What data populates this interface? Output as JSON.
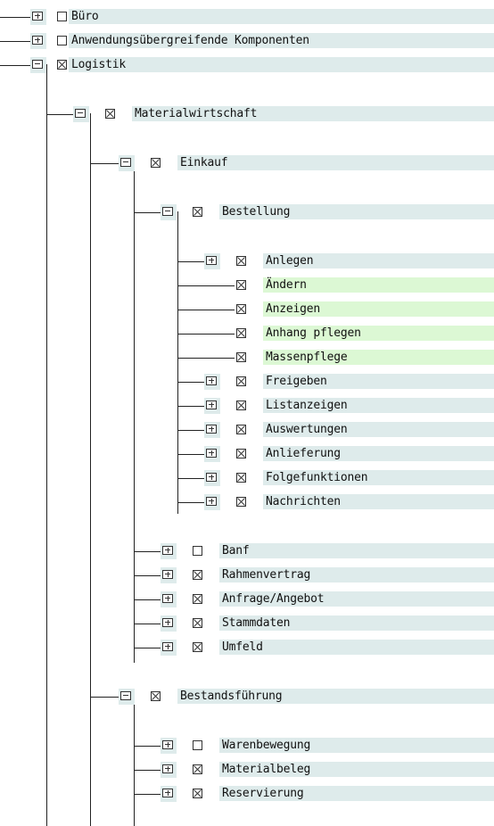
{
  "tree": {
    "nodes": [
      {
        "label": "Büro",
        "level": 0,
        "expander": "plus",
        "checked": false,
        "highlight": false
      },
      {
        "label": "Anwendungsübergreifende Komponenten",
        "level": 0,
        "expander": "plus",
        "checked": false,
        "highlight": false
      },
      {
        "label": "Logistik",
        "level": 0,
        "expander": "minus",
        "checked": true,
        "highlight": false
      },
      {
        "label": "Materialwirtschaft",
        "level": 1,
        "expander": "minus",
        "checked": true,
        "highlight": false
      },
      {
        "label": "Einkauf",
        "level": 2,
        "expander": "minus",
        "checked": true,
        "highlight": false
      },
      {
        "label": "Bestellung",
        "level": 3,
        "expander": "minus",
        "checked": true,
        "highlight": false
      },
      {
        "label": "Anlegen",
        "level": 4,
        "expander": "plus",
        "checked": true,
        "highlight": false
      },
      {
        "label": "Ändern",
        "level": 4,
        "expander": "none",
        "checked": true,
        "highlight": true
      },
      {
        "label": "Anzeigen",
        "level": 4,
        "expander": "none",
        "checked": true,
        "highlight": true
      },
      {
        "label": "Anhang pflegen",
        "level": 4,
        "expander": "none",
        "checked": true,
        "highlight": true
      },
      {
        "label": "Massenpflege",
        "level": 4,
        "expander": "none",
        "checked": true,
        "highlight": true
      },
      {
        "label": "Freigeben",
        "level": 4,
        "expander": "plus",
        "checked": true,
        "highlight": false
      },
      {
        "label": "Listanzeigen",
        "level": 4,
        "expander": "plus",
        "checked": true,
        "highlight": false
      },
      {
        "label": "Auswertungen",
        "level": 4,
        "expander": "plus",
        "checked": true,
        "highlight": false
      },
      {
        "label": "Anlieferung",
        "level": 4,
        "expander": "plus",
        "checked": true,
        "highlight": false
      },
      {
        "label": "Folgefunktionen",
        "level": 4,
        "expander": "plus",
        "checked": true,
        "highlight": false
      },
      {
        "label": "Nachrichten",
        "level": 4,
        "expander": "plus",
        "checked": true,
        "highlight": false
      },
      {
        "label": "Banf",
        "level": 3,
        "expander": "plus",
        "checked": false,
        "highlight": false
      },
      {
        "label": "Rahmenvertrag",
        "level": 3,
        "expander": "plus",
        "checked": true,
        "highlight": false
      },
      {
        "label": "Anfrage/Angebot",
        "level": 3,
        "expander": "plus",
        "checked": true,
        "highlight": false
      },
      {
        "label": "Stammdaten",
        "level": 3,
        "expander": "plus",
        "checked": true,
        "highlight": false
      },
      {
        "label": "Umfeld",
        "level": 3,
        "expander": "plus",
        "checked": true,
        "highlight": false
      },
      {
        "label": "Bestandsführung",
        "level": 2,
        "expander": "minus",
        "checked": true,
        "highlight": false
      },
      {
        "label": "Warenbewegung",
        "level": 3,
        "expander": "plus",
        "checked": false,
        "highlight": false
      },
      {
        "label": "Materialbeleg",
        "level": 3,
        "expander": "plus",
        "checked": true,
        "highlight": false
      },
      {
        "label": "Reservierung",
        "level": 3,
        "expander": "plus",
        "checked": true,
        "highlight": false
      }
    ]
  },
  "colors": {
    "row_background": "#deebeb",
    "highlight_background": "#dcf8d4",
    "line": "#222222"
  }
}
